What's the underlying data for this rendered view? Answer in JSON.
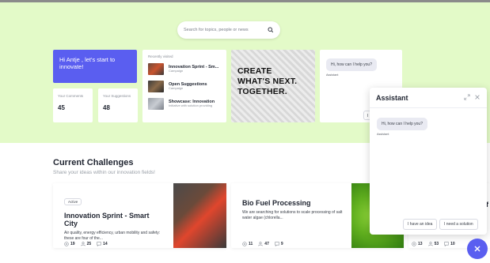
{
  "search": {
    "placeholder": "Search for topics, people or news",
    "icon": "search-icon"
  },
  "welcome": {
    "text": "Hi Antje , let's start to innovate!"
  },
  "stats": [
    {
      "label": "Your Comments",
      "value": "45"
    },
    {
      "label": "Your Suggestions",
      "value": "48"
    }
  ],
  "recent": {
    "title": "Recently visited",
    "items": [
      {
        "title": "Innovation Sprint - Sm...",
        "subtitle": "Campaign"
      },
      {
        "title": "Open Suggestions",
        "subtitle": "Campaign"
      },
      {
        "title": "Showcase: Innovation",
        "subtitle": "Initiative with solution providing"
      }
    ]
  },
  "banner": {
    "line1": "CREATE",
    "line2": "WHAT'S NEXT.",
    "line3": "TOGETHER."
  },
  "chat_preview": {
    "greeting": "Hi, how can I help you?",
    "sender": "Assistant",
    "chip": "I h"
  },
  "challenges": {
    "title": "Current Challenges",
    "subtitle": "Share your ideas within our innovation fields!",
    "cards": [
      {
        "badge": "Active",
        "title": "Innovation Sprint - Smart City",
        "description": "Air quality, energy efficiency, urban mobility and safety: these are four of the...",
        "views": "19",
        "members": "25",
        "comments": "14"
      },
      {
        "title": "Bio Fuel Processing",
        "description": "We are searching for solutions to scale processing of salt water algae (chlorella...",
        "views": "11",
        "members": "47",
        "comments": "9"
      },
      {
        "title": "f",
        "views": "13",
        "members": "53",
        "comments": "10"
      }
    ]
  },
  "assistant": {
    "title": "Assistant",
    "greeting": "Hi, how can I help you?",
    "sender": "Assistant",
    "buttons": [
      "I have an idea",
      "I need a solution"
    ]
  },
  "colors": {
    "accent": "#5a5ef0",
    "hero_bg": "#e3fac8"
  }
}
